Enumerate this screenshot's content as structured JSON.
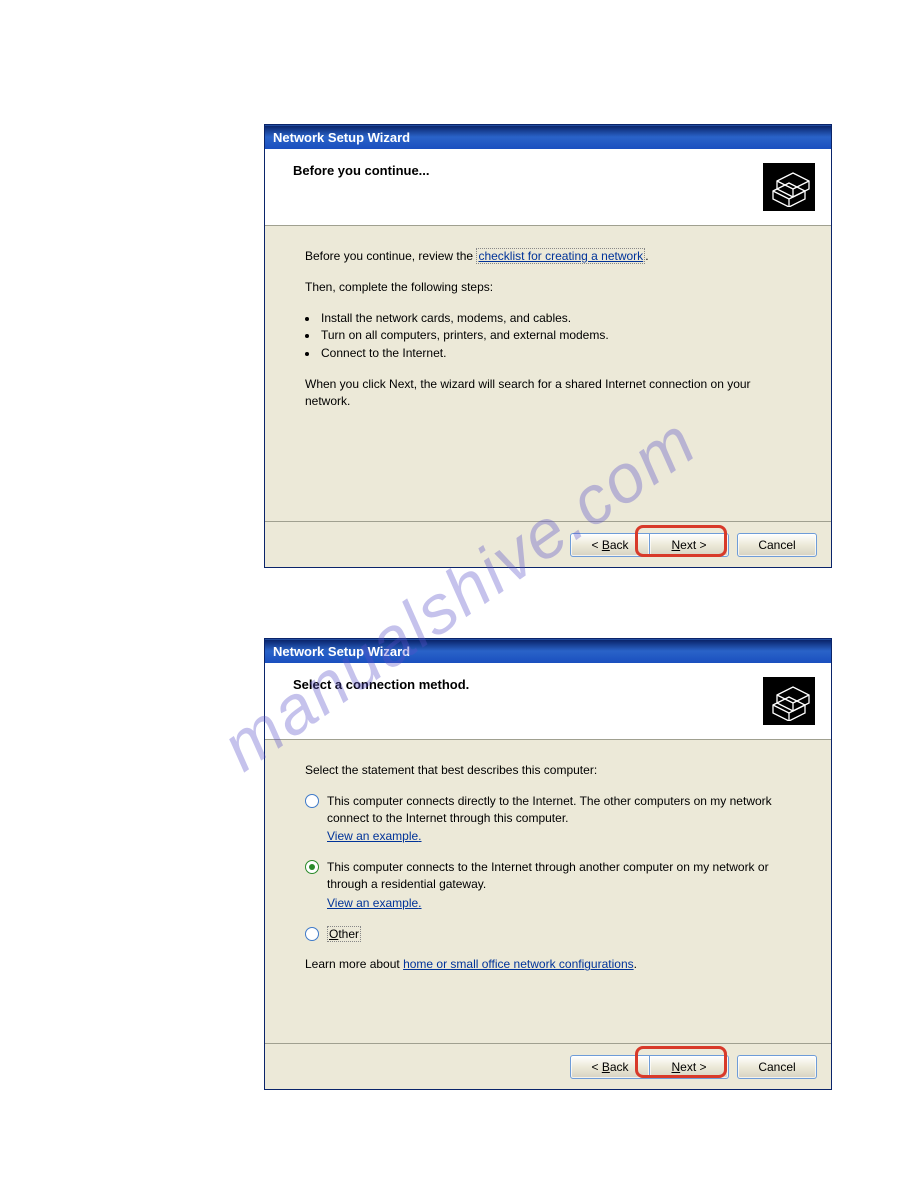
{
  "watermark": "manualshive.com",
  "wizard1": {
    "title": "Network Setup Wizard",
    "heading": "Before you continue...",
    "intro_prefix": "Before you continue, review the ",
    "intro_link": "checklist for creating a network",
    "intro_suffix": ".",
    "then": "Then, complete the following steps:",
    "steps": [
      "Install the network cards, modems, and cables.",
      "Turn on all computers, printers, and external modems.",
      "Connect to the Internet."
    ],
    "note": "When you click Next, the wizard will search for a shared Internet connection on your network.",
    "buttons": {
      "back": "< Back",
      "next": "Next >",
      "cancel": "Cancel"
    }
  },
  "wizard2": {
    "title": "Network Setup Wizard",
    "heading": "Select a connection method.",
    "instruction": "Select the statement that best describes this computer:",
    "options": [
      {
        "text": "This computer connects directly to the Internet. The other computers on my network connect to the Internet through this computer.",
        "link": "View an example",
        "selected": false
      },
      {
        "text": "This computer connects to the Internet through another computer on my network or through a residential gateway.",
        "link": "View an example",
        "selected": true
      },
      {
        "text": "Other",
        "link": "",
        "selected": false
      }
    ],
    "learn_prefix": "Learn more about ",
    "learn_link": "home or small office network configurations",
    "learn_suffix": ".",
    "buttons": {
      "back": "< Back",
      "next": "Next >",
      "cancel": "Cancel"
    }
  }
}
